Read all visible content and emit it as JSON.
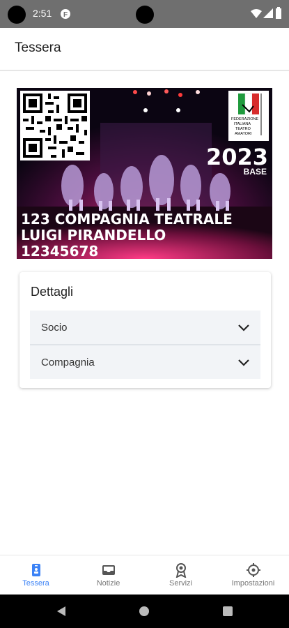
{
  "status_bar": {
    "time": "2:51"
  },
  "app_bar": {
    "title": "Tessera"
  },
  "membership_card": {
    "org_name_line1": "123 COMPAGNIA TEATRALE",
    "org_name_line2": "LUIGI PIRANDELLO",
    "member_number": "12345678",
    "year": "2023",
    "tier": "BASE",
    "logo_text": "FEDERAZIONE ITALIANA TEATRO AMATORI"
  },
  "details": {
    "heading": "Dettagli",
    "sections": [
      {
        "label": "Socio"
      },
      {
        "label": "Compagnia"
      }
    ]
  },
  "bottom_nav": {
    "items": [
      {
        "label": "Tessera",
        "icon": "badge-icon",
        "active": true
      },
      {
        "label": "Notizie",
        "icon": "inbox-icon",
        "active": false
      },
      {
        "label": "Servizi",
        "icon": "award-icon",
        "active": false
      },
      {
        "label": "Impostazioni",
        "icon": "gear-icon",
        "active": false
      }
    ]
  },
  "colors": {
    "accent": "#3b82f6",
    "status_bar": "#6f6f6f",
    "accordion_bg": "#f2f4f7"
  }
}
